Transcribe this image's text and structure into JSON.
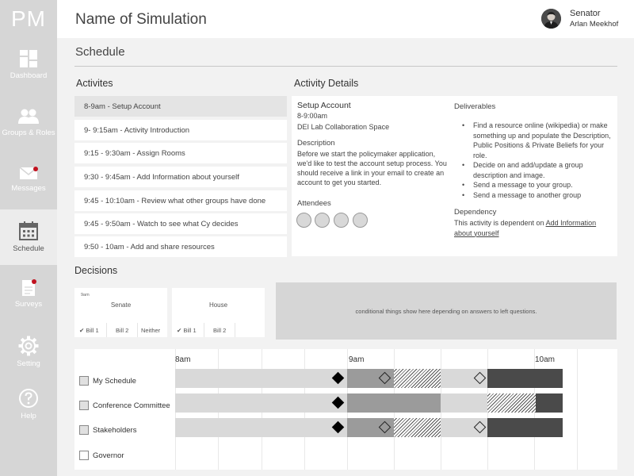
{
  "app": {
    "logo": "PM",
    "title": "Name of Simulation"
  },
  "user": {
    "role": "Senator",
    "name": "Arlan Meekhof"
  },
  "nav": [
    {
      "label": "Dashboard",
      "icon": "dashboard-icon",
      "active": false,
      "badge": false
    },
    {
      "label": "Groups & Roles",
      "icon": "groups-icon",
      "active": false,
      "badge": false
    },
    {
      "label": "Messages",
      "icon": "envelope-icon",
      "active": false,
      "badge": true
    },
    {
      "label": "Schedule",
      "icon": "calendar-icon",
      "active": true,
      "badge": false
    },
    {
      "label": "Surveys",
      "icon": "survey-icon",
      "active": false,
      "badge": true
    },
    {
      "label": "Setting",
      "icon": "gear-icon",
      "active": false,
      "badge": false
    },
    {
      "label": "Help",
      "icon": "help-icon",
      "active": false,
      "badge": false
    }
  ],
  "schedule": {
    "title": "Schedule",
    "activities_heading": "Activites",
    "details_heading": "Activity Details",
    "activities": [
      "8-9am - Setup Account",
      "9- 9:15am - Activity Introduction",
      "9:15 - 9:30am - Assign Rooms",
      "9:30 - 9:45am - Add Information about yourself",
      "9:45 - 10:10am - Review what other groups have done",
      "9:45 - 9:50am - Watch to see what Cy decides",
      "9:50 - 10am - Add and share resources"
    ],
    "selected_index": 0
  },
  "details": {
    "title": "Setup Account",
    "time": "8-9:00am",
    "location": "DEI Lab Collaboration Space",
    "description_heading": "Description",
    "description": "Before we start the policymaker application, we'd like to test the account setup process. You should receive a link in your email to create an account to get you started.",
    "attendees_heading": "Attendees",
    "attendee_count": 4,
    "deliverables_heading": "Deliverables",
    "deliverables": [
      "Find a resource online (wikipedia) or make something up and populate the Description, Public Positions & Private Beliefs for your role.",
      "Decide on and add/update a group description and image.",
      "Send a message to your group.",
      "Send a message to another group"
    ],
    "dependency_heading": "Dependency",
    "dependency_prefix": "This activity is dependent on ",
    "dependency_link": "Add Information about yourself"
  },
  "decisions": {
    "heading": "Decisions",
    "cards": [
      {
        "time": "9am",
        "chamber": "Senate",
        "options": [
          "Bill 1",
          "Bill 2",
          "Neither"
        ],
        "selected": 0
      },
      {
        "time": "",
        "chamber": "House",
        "options": [
          "Bill 1",
          "Bill 2"
        ],
        "selected": 0
      }
    ],
    "conditional_text": "conditional things show here depending on answers to left questions."
  },
  "timeline": {
    "hours": [
      "8am",
      "9am",
      "10am"
    ],
    "rows": [
      {
        "label": "My Schedule",
        "checked": true
      },
      {
        "label": "Conference Committee",
        "checked": true
      },
      {
        "label": "Stakeholders",
        "checked": true
      },
      {
        "label": "Governor",
        "checked": false
      }
    ]
  }
}
